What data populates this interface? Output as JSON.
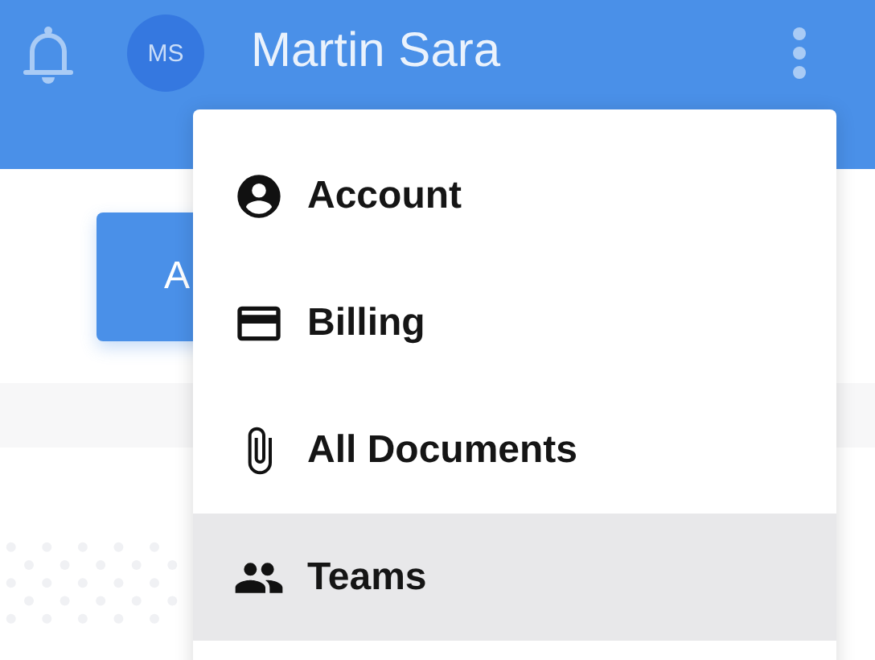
{
  "header": {
    "user_initials": "MS",
    "user_name": "Martin Sara"
  },
  "main": {
    "button_label": "A"
  },
  "menu": {
    "items": [
      {
        "kind": "account",
        "label": "Account",
        "selected": false
      },
      {
        "kind": "billing",
        "label": "Billing",
        "selected": false
      },
      {
        "kind": "documents",
        "label": "All Documents",
        "selected": false
      },
      {
        "kind": "teams",
        "label": "Teams",
        "selected": true
      }
    ]
  }
}
